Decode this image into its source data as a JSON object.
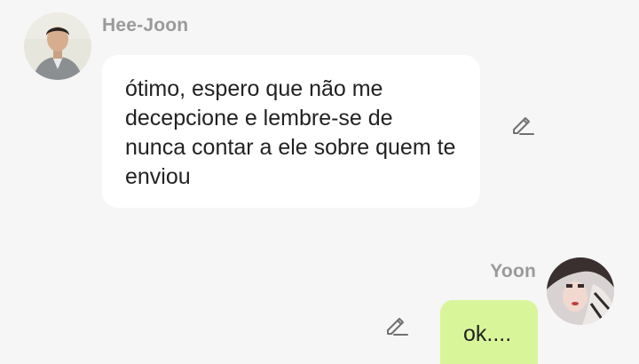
{
  "messages": [
    {
      "sender": "Hee-Joon",
      "text": "ótimo, espero que não me decepcione e lembre-se de nunca contar a ele sobre quem te enviou",
      "direction": "incoming",
      "bubble_color": "#ffffff",
      "action_icon": "pencil-edit-icon"
    },
    {
      "sender": "Yoon",
      "text": "ok....",
      "direction": "outgoing",
      "bubble_color": "#d9f59a",
      "action_icon": "pencil-edit-icon"
    }
  ],
  "colors": {
    "background": "#f6f6f6",
    "sender_name": "#9a9a9a",
    "text": "#222222"
  }
}
